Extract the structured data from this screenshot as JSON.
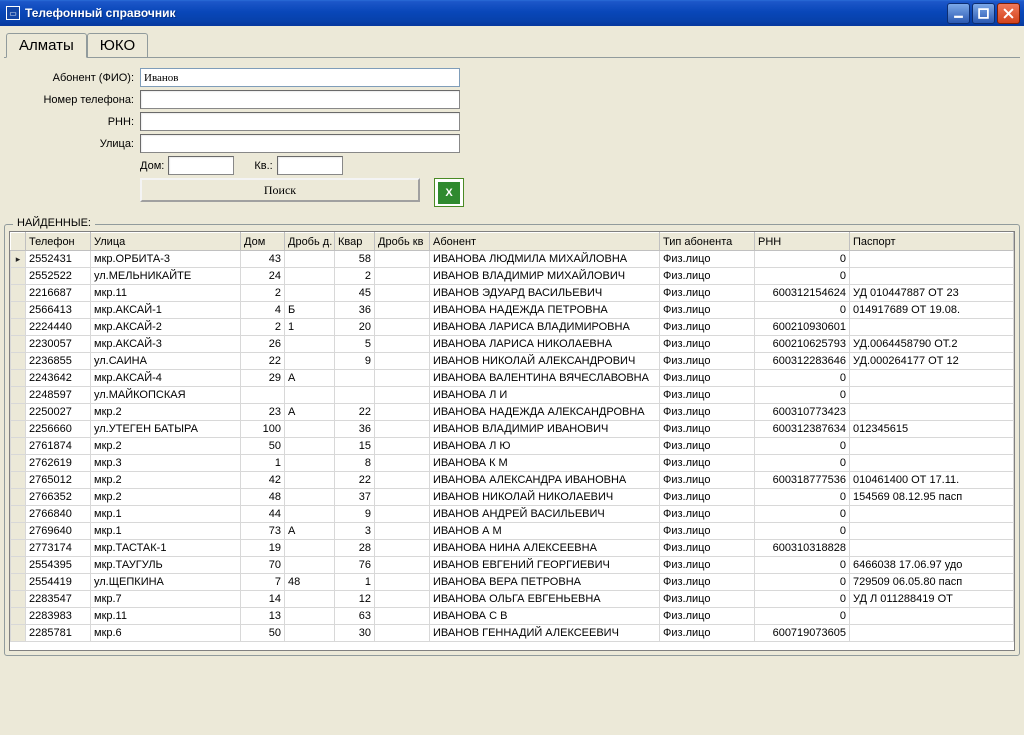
{
  "window": {
    "title": "Телефонный справочник"
  },
  "tabs": {
    "active": "Алматы",
    "other": "ЮКО"
  },
  "form": {
    "labels": {
      "fio": "Абонент (ФИО):",
      "phone": "Номер телефона:",
      "rnn": "РНН:",
      "street": "Улица:",
      "house": "Дом:",
      "flat": "Кв.:",
      "search": "Поиск"
    },
    "values": {
      "fio": "Иванов",
      "phone": "",
      "rnn": "",
      "street": "",
      "house": "",
      "flat": ""
    }
  },
  "found": {
    "legend": "НАЙДЕННЫЕ:",
    "columns": {
      "phone": "Телефон",
      "street": "Улица",
      "house": "Дом",
      "drob": "Дробь д.",
      "kvart": "Квар",
      "drobkv": "Дробь кв",
      "abon": "Абонент",
      "type": "Тип абонента",
      "rnn": "РНН",
      "pass": "Паспорт"
    },
    "rows": [
      {
        "cur": true,
        "phone": "2552431",
        "street": "мкр.ОРБИТА-3",
        "house": "43",
        "drob": "",
        "kvart": "58",
        "drobkv": "",
        "abon": "ИВАНОВА ЛЮДМИЛА МИХАЙЛОВНА",
        "type": "Физ.лицо",
        "rnn": "0",
        "pass": ""
      },
      {
        "phone": "2552522",
        "street": "ул.МЕЛЬНИКАЙТЕ",
        "house": "24",
        "drob": "",
        "kvart": "2",
        "drobkv": "",
        "abon": "ИВАНОВ ВЛАДИМИР МИХАЙЛОВИЧ",
        "type": "Физ.лицо",
        "rnn": "0",
        "pass": ""
      },
      {
        "phone": "2216687",
        "street": "мкр.11",
        "house": "2",
        "drob": "",
        "kvart": "45",
        "drobkv": "",
        "abon": "ИВАНОВ ЭДУАРД ВАСИЛЬЕВИЧ",
        "type": "Физ.лицо",
        "rnn": "600312154624",
        "pass": "УД 010447887 ОТ 23"
      },
      {
        "phone": "2566413",
        "street": "мкр.АКСАЙ-1",
        "house": "4",
        "drob": "Б",
        "kvart": "36",
        "drobkv": "",
        "abon": "ИВАНОВА НАДЕЖДА ПЕТРОВНА",
        "type": "Физ.лицо",
        "rnn": "0",
        "pass": "014917689 ОТ 19.08."
      },
      {
        "phone": "2224440",
        "street": "мкр.АКСАЙ-2",
        "house": "2",
        "drob": "1",
        "kvart": "20",
        "drobkv": "",
        "abon": "ИВАНОВА ЛАРИСА ВЛАДИМИРОВНА",
        "type": "Физ.лицо",
        "rnn": "600210930601",
        "pass": ""
      },
      {
        "phone": "2230057",
        "street": "мкр.АКСАЙ-3",
        "house": "26",
        "drob": "",
        "kvart": "5",
        "drobkv": "",
        "abon": "ИВАНОВА ЛАРИСА НИКОЛАЕВНА",
        "type": "Физ.лицо",
        "rnn": "600210625793",
        "pass": "УД.0064458790 ОТ.2"
      },
      {
        "phone": "2236855",
        "street": "ул.САИНА",
        "house": "22",
        "drob": "",
        "kvart": "9",
        "drobkv": "",
        "abon": "ИВАНОВ НИКОЛАЙ АЛЕКСАНДРОВИЧ",
        "type": "Физ.лицо",
        "rnn": "600312283646",
        "pass": "УД.000264177 ОТ 12"
      },
      {
        "phone": "2243642",
        "street": "мкр.АКСАЙ-4",
        "house": "29",
        "drob": "А",
        "kvart": "",
        "drobkv": "",
        "abon": "ИВАНОВА ВАЛЕНТИНА ВЯЧЕСЛАВОВНА",
        "type": "Физ.лицо",
        "rnn": "0",
        "pass": ""
      },
      {
        "phone": "2248597",
        "street": "ул.МАЙКОПСКАЯ",
        "house": "",
        "drob": "",
        "kvart": "",
        "drobkv": "",
        "abon": "ИВАНОВА Л И",
        "type": "Физ.лицо",
        "rnn": "0",
        "pass": ""
      },
      {
        "phone": "2250027",
        "street": "мкр.2",
        "house": "23",
        "drob": "А",
        "kvart": "22",
        "drobkv": "",
        "abon": "ИВАНОВА НАДЕЖДА АЛЕКСАНДРОВНА",
        "type": "Физ.лицо",
        "rnn": "600310773423",
        "pass": ""
      },
      {
        "phone": "2256660",
        "street": "ул.УТЕГЕН БАТЫРА",
        "house": "100",
        "drob": "",
        "kvart": "36",
        "drobkv": "",
        "abon": "ИВАНОВ ВЛАДИМИР ИВАНОВИЧ",
        "type": "Физ.лицо",
        "rnn": "600312387634",
        "pass": "012345615"
      },
      {
        "phone": "2761874",
        "street": "мкр.2",
        "house": "50",
        "drob": "",
        "kvart": "15",
        "drobkv": "",
        "abon": "ИВАНОВА Л Ю",
        "type": "Физ.лицо",
        "rnn": "0",
        "pass": ""
      },
      {
        "phone": "2762619",
        "street": "мкр.3",
        "house": "1",
        "drob": "",
        "kvart": "8",
        "drobkv": "",
        "abon": "ИВАНОВА К М",
        "type": "Физ.лицо",
        "rnn": "0",
        "pass": ""
      },
      {
        "phone": "2765012",
        "street": "мкр.2",
        "house": "42",
        "drob": "",
        "kvart": "22",
        "drobkv": "",
        "abon": "ИВАНОВА АЛЕКСАНДРА ИВАНОВНА",
        "type": "Физ.лицо",
        "rnn": "600318777536",
        "pass": "010461400 ОТ 17.11."
      },
      {
        "phone": "2766352",
        "street": "мкр.2",
        "house": "48",
        "drob": "",
        "kvart": "37",
        "drobkv": "",
        "abon": "ИВАНОВ НИКОЛАЙ НИКОЛАЕВИЧ",
        "type": "Физ.лицо",
        "rnn": "0",
        "pass": "154569 08.12.95 пасп"
      },
      {
        "phone": "2766840",
        "street": "мкр.1",
        "house": "44",
        "drob": "",
        "kvart": "9",
        "drobkv": "",
        "abon": "ИВАНОВ АНДРЕЙ ВАСИЛЬЕВИЧ",
        "type": "Физ.лицо",
        "rnn": "0",
        "pass": ""
      },
      {
        "phone": "2769640",
        "street": "мкр.1",
        "house": "73",
        "drob": "А",
        "kvart": "3",
        "drobkv": "",
        "abon": "ИВАНОВ А М",
        "type": "Физ.лицо",
        "rnn": "0",
        "pass": ""
      },
      {
        "phone": "2773174",
        "street": "мкр.ТАСТАК-1",
        "house": "19",
        "drob": "",
        "kvart": "28",
        "drobkv": "",
        "abon": "ИВАНОВА НИНА АЛЕКСЕЕВНА",
        "type": "Физ.лицо",
        "rnn": "600310318828",
        "pass": ""
      },
      {
        "phone": "2554395",
        "street": "мкр.ТАУГУЛЬ",
        "house": "70",
        "drob": "",
        "kvart": "76",
        "drobkv": "",
        "abon": "ИВАНОВ ЕВГЕНИЙ ГЕОРГИЕВИЧ",
        "type": "Физ.лицо",
        "rnn": "0",
        "pass": "6466038 17.06.97 удо"
      },
      {
        "phone": "2554419",
        "street": "ул.ЩЕПКИНА",
        "house": "7",
        "drob": "48",
        "kvart": "1",
        "drobkv": "",
        "abon": "ИВАНОВА ВЕРА ПЕТРОВНА",
        "type": "Физ.лицо",
        "rnn": "0",
        "pass": "729509 06.05.80 пасп"
      },
      {
        "phone": "2283547",
        "street": "мкр.7",
        "house": "14",
        "drob": "",
        "kvart": "12",
        "drobkv": "",
        "abon": "ИВАНОВА ОЛЬГА ЕВГЕНЬЕВНА",
        "type": "Физ.лицо",
        "rnn": "0",
        "pass": "УД Л 011288419 ОТ"
      },
      {
        "phone": "2283983",
        "street": "мкр.11",
        "house": "13",
        "drob": "",
        "kvart": "63",
        "drobkv": "",
        "abon": "ИВАНОВА С В",
        "type": "Физ.лицо",
        "rnn": "0",
        "pass": ""
      },
      {
        "phone": "2285781",
        "street": "мкр.6",
        "house": "50",
        "drob": "",
        "kvart": "30",
        "drobkv": "",
        "abon": "ИВАНОВ ГЕННАДИЙ АЛЕКСЕЕВИЧ",
        "type": "Физ.лицо",
        "rnn": "600719073605",
        "pass": ""
      }
    ]
  }
}
